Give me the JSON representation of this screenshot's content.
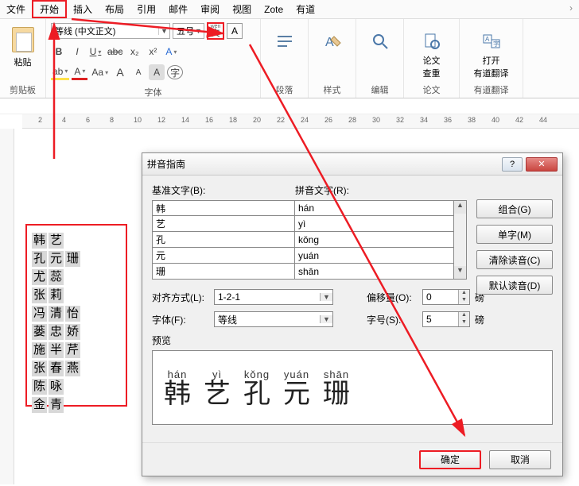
{
  "menu": {
    "items": [
      "文件",
      "开始",
      "插入",
      "布局",
      "引用",
      "邮件",
      "审阅",
      "视图",
      "Zote",
      "有道"
    ],
    "active_index": 1,
    "more": "›"
  },
  "ribbon": {
    "clipboard": {
      "paste": "粘贴",
      "label": "剪贴板"
    },
    "font": {
      "font_name": "等线 (中文正文)",
      "font_size": "五号",
      "ruby_top": "wén",
      "ruby_bot": "文",
      "charbox": "A",
      "bold": "B",
      "italic": "I",
      "underline": "U",
      "strike": "abc",
      "sub": "x₂",
      "sup": "x²",
      "texteffects": "A",
      "highlight": "ab",
      "fontcolor": "A",
      "caseA": "Aa",
      "bigA": "A",
      "smallA": "A",
      "circleA": "A",
      "styleA": "字",
      "label": "字体"
    },
    "para_label": "段落",
    "styles_label": "样式",
    "edit_label": "编辑",
    "lunwen": {
      "line1": "论文",
      "line2": "查重",
      "label": "论文"
    },
    "youdao": {
      "line1": "打开",
      "line2": "有道翻译",
      "label": "有道翻译"
    }
  },
  "ruler_marks": [
    "2",
    "4",
    "6",
    "8",
    "10",
    "12",
    "14",
    "16",
    "18",
    "20",
    "22",
    "24",
    "26",
    "28",
    "30",
    "32",
    "34",
    "36",
    "38",
    "40",
    "42",
    "44"
  ],
  "names": [
    [
      "韩",
      "艺"
    ],
    [
      "孔",
      "元",
      "珊"
    ],
    [
      "尤",
      "蕊"
    ],
    [
      "张",
      "莉"
    ],
    [
      "冯",
      "清",
      "怡"
    ],
    [
      "蒌",
      "忠",
      "娇"
    ],
    [
      "施",
      "半",
      "芹"
    ],
    [
      "张",
      "春",
      "燕"
    ],
    [
      "陈",
      "咏"
    ],
    [
      "金",
      "青"
    ]
  ],
  "dialog": {
    "title": "拼音指南",
    "help": "?",
    "close": "✕",
    "base_label": "基准文字(B):",
    "ruby_label": "拼音文字(R):",
    "rows": [
      {
        "base": "韩",
        "ruby": "hán"
      },
      {
        "base": "艺",
        "ruby": "yì"
      },
      {
        "base": "孔",
        "ruby": "kǒng"
      },
      {
        "base": "元",
        "ruby": "yuán"
      },
      {
        "base": "珊",
        "ruby": "shān"
      }
    ],
    "side_buttons": {
      "combine": "组合(G)",
      "mono": "单字(M)",
      "clear": "清除读音(C)",
      "default": "默认读音(D)"
    },
    "align_label": "对齐方式(L):",
    "align_value": "1-2-1",
    "offset_label": "偏移量(O):",
    "offset_value": "0",
    "offset_unit": "磅",
    "font_label": "字体(F):",
    "font_value": "等线",
    "size_label": "字号(S):",
    "size_value": "5",
    "size_unit": "磅",
    "preview_label": "预览",
    "preview": [
      {
        "r": "hán",
        "b": "韩"
      },
      {
        "r": "yì",
        "b": "艺"
      },
      {
        "r": "kǒng",
        "b": "孔"
      },
      {
        "r": "yuán",
        "b": "元"
      },
      {
        "r": "shān",
        "b": "珊"
      }
    ],
    "ok": "确定",
    "cancel": "取消"
  }
}
